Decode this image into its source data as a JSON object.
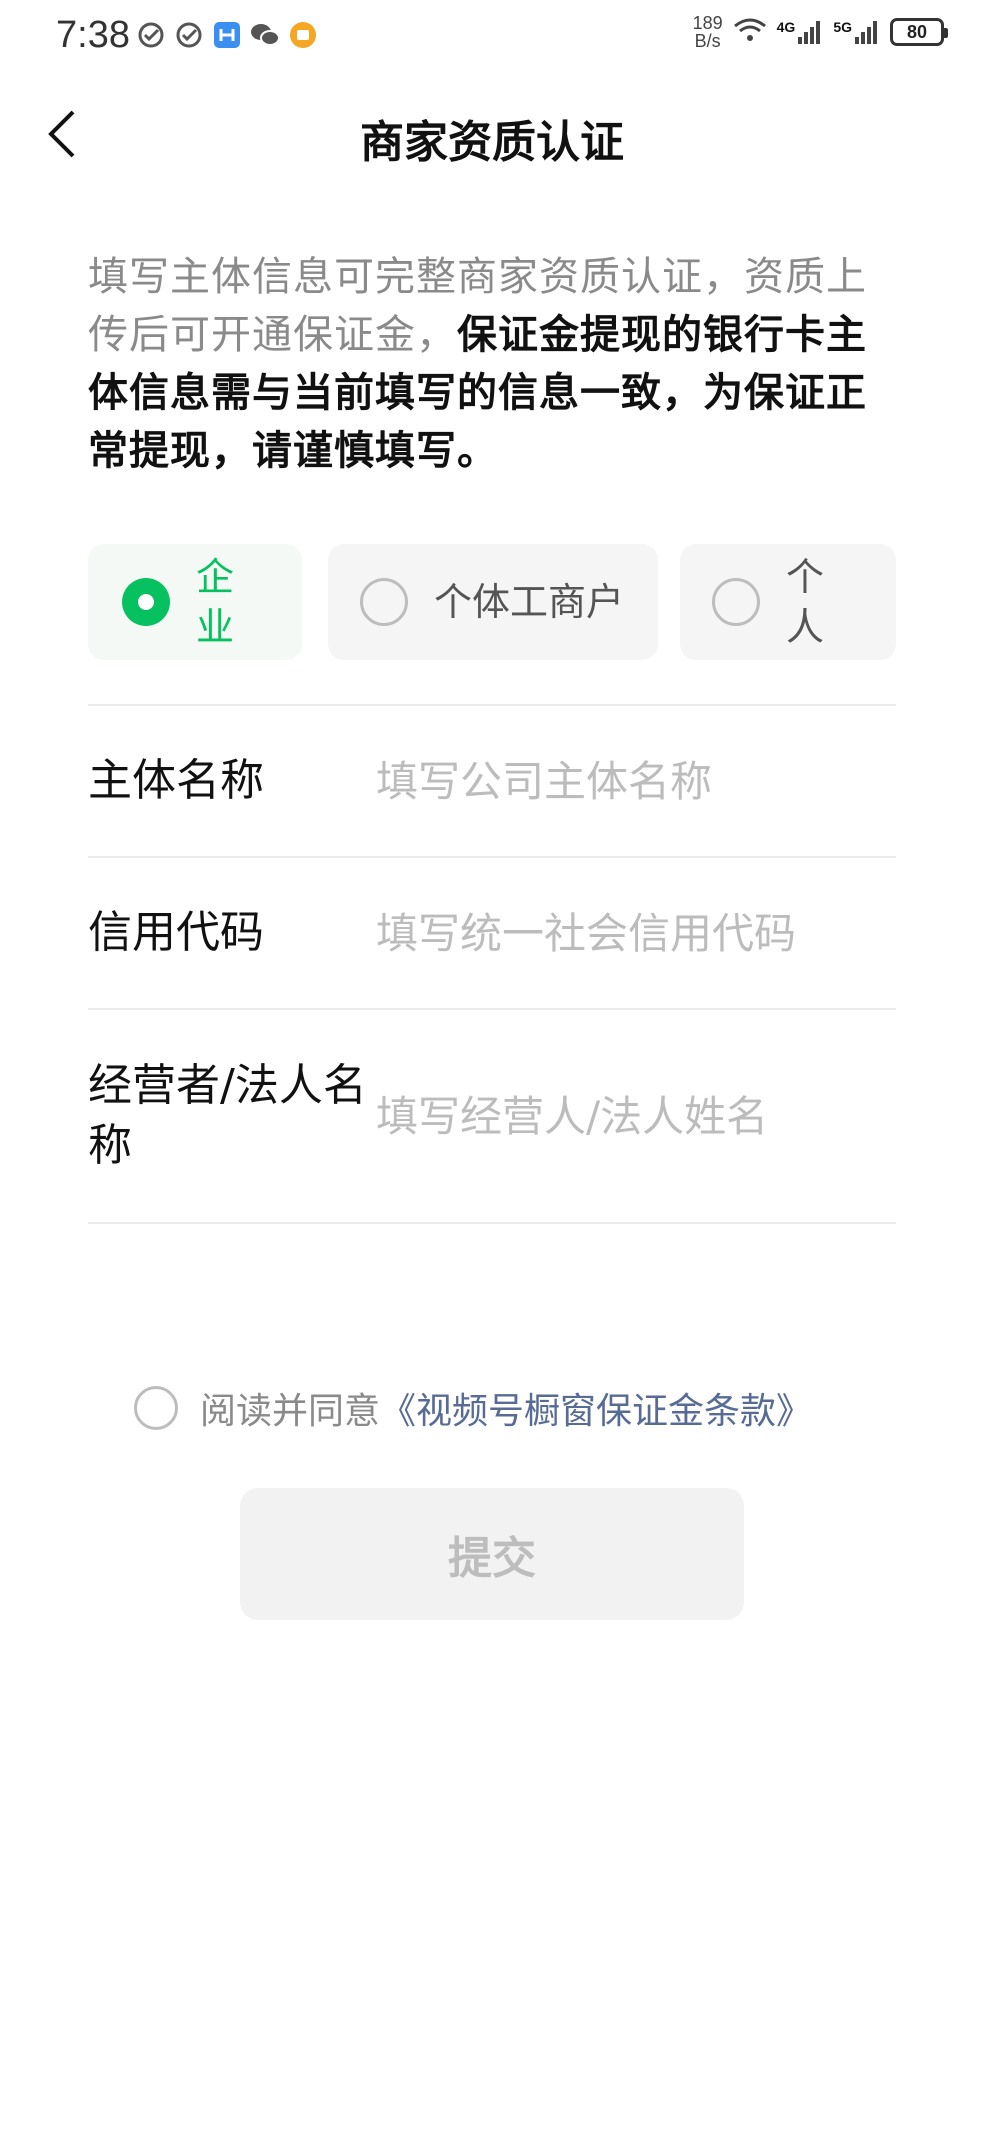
{
  "status_bar": {
    "time": "7:38",
    "net_speed_value": "189",
    "net_speed_unit": "B/s",
    "signal_1": "4G",
    "signal_2": "5G",
    "battery": "80"
  },
  "nav": {
    "title": "商家资质认证"
  },
  "intro": {
    "normal_text": "填写主体信息可完整商家资质认证，资质上传后可开通保证金，",
    "bold_text": "保证金提现的银行卡主体信息需与当前填写的信息一致，为保证正常提现，请谨慎填写。"
  },
  "entity_types": [
    {
      "label": "企业",
      "selected": true
    },
    {
      "label": "个体工商户",
      "selected": false
    },
    {
      "label": "个人",
      "selected": false
    }
  ],
  "form": {
    "fields": [
      {
        "label": "主体名称",
        "value": "",
        "placeholder": "填写公司主体名称"
      },
      {
        "label": "信用代码",
        "value": "",
        "placeholder": "填写统一社会信用代码"
      },
      {
        "label": "经营者/法人名称",
        "value": "",
        "placeholder": "填写经营人/法人姓名"
      }
    ]
  },
  "agreement": {
    "prefix": "阅读并同意",
    "link": "《视频号橱窗保证金条款》",
    "checked": false
  },
  "submit": {
    "label": "提交"
  },
  "colors": {
    "accent": "#07c160",
    "link": "#576b95"
  }
}
